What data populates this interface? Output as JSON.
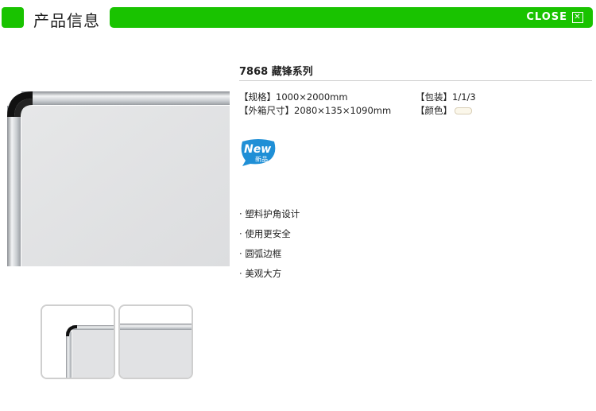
{
  "header": {
    "title": "产品信息",
    "close_label": "CLOSE",
    "close_icon": "✕"
  },
  "product": {
    "name": "7868 藏锋系列",
    "specs": {
      "size_label": "【规格】",
      "size_value": "1000×2000mm",
      "packing_label": "【包装】",
      "packing_value": "1/1/3",
      "outer_box_label": "【外箱尺寸】",
      "outer_box_value": "2080×135×1090mm",
      "color_label": "【颜色】"
    },
    "badge": {
      "text": "New",
      "subtext": "新品"
    },
    "features": [
      "塑料护角设计",
      "使用更安全",
      "圆弧边框",
      "美观大方"
    ]
  },
  "colors": {
    "brand_green": "#19c300",
    "badge_blue": "#1f8fd6"
  }
}
